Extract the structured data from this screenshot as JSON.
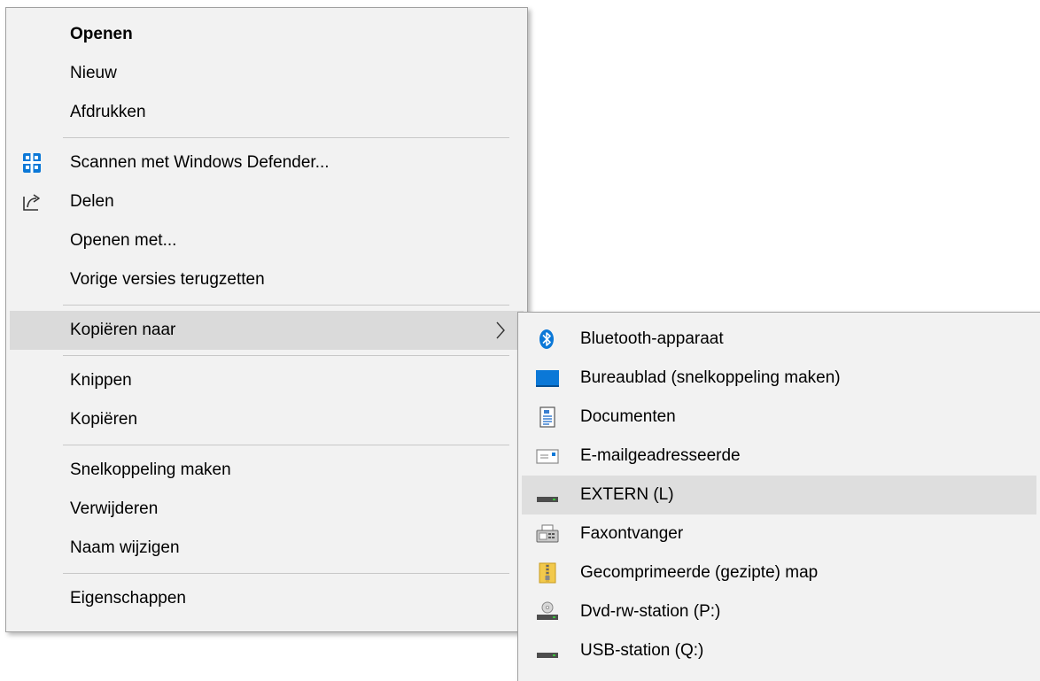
{
  "context_menu": {
    "items": [
      {
        "label": "Openen"
      },
      {
        "label": "Nieuw"
      },
      {
        "label": "Afdrukken"
      },
      {
        "label": "Scannen met Windows Defender..."
      },
      {
        "label": "Delen"
      },
      {
        "label": "Openen met..."
      },
      {
        "label": "Vorige versies terugzetten"
      },
      {
        "label": "Kopiëren naar"
      },
      {
        "label": "Knippen"
      },
      {
        "label": "Kopiëren"
      },
      {
        "label": "Snelkoppeling maken"
      },
      {
        "label": "Verwijderen"
      },
      {
        "label": "Naam wijzigen"
      },
      {
        "label": "Eigenschappen"
      }
    ]
  },
  "submenu": {
    "items": [
      {
        "label": "Bluetooth-apparaat",
        "icon": "bluetooth-icon"
      },
      {
        "label": "Bureaublad (snelkoppeling maken)",
        "icon": "desktop-icon"
      },
      {
        "label": "Documenten",
        "icon": "documents-icon"
      },
      {
        "label": "E-mailgeadresseerde",
        "icon": "mail-recipient-icon"
      },
      {
        "label": "EXTERN (L)",
        "icon": "drive-icon"
      },
      {
        "label": "Faxontvanger",
        "icon": "fax-icon"
      },
      {
        "label": "Gecomprimeerde (gezipte) map",
        "icon": "zip-folder-icon"
      },
      {
        "label": "Dvd-rw-station (P:)",
        "icon": "dvd-drive-icon"
      },
      {
        "label": "USB-station (Q:)",
        "icon": "usb-drive-icon"
      }
    ]
  },
  "colors": {
    "menu_background": "#f2f2f2",
    "hover_background": "#dadada",
    "separator": "#c8c8c8",
    "accent_blue": "#0b78d7"
  }
}
